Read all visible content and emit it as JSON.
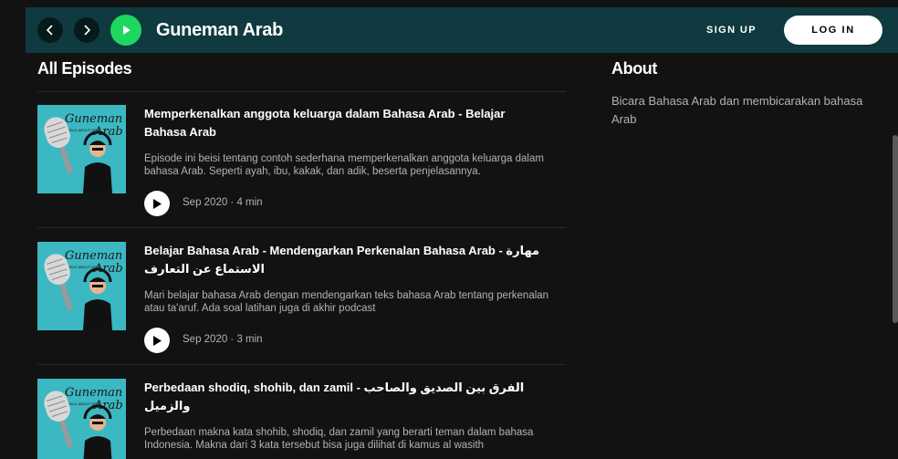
{
  "header": {
    "title": "Guneman Arab",
    "signup_label": "SIGN UP",
    "login_label": "LOG IN"
  },
  "sections": {
    "episodes_title": "All Episodes",
    "about_title": "About",
    "about_text": "Bicara Bahasa Arab dan membicarakan bahasa Arab"
  },
  "cover_art": {
    "brand_line1": "Guneman",
    "brand_line2": "Arab",
    "tagline": "TALK ABOUT ARAB"
  },
  "episodes": [
    {
      "title": "Memperkenalkan anggota keluarga dalam Bahasa Arab - Belajar Bahasa Arab",
      "description": "Episode ini beisi tentang contoh sederhana memperkenalkan anggota keluarga dalam bahasa Arab. Seperti ayah, ibu, kakak, dan adik, beserta penjelasannya.",
      "meta": "Sep 2020 · 4 min"
    },
    {
      "title": "Belajar Bahasa Arab - Mendengarkan Perkenalan Bahasa Arab - مهارة الاستماع عن التعارف",
      "description": "Mari belajar bahasa Arab dengan mendengarkan teks bahasa Arab tentang perkenalan atau ta'aruf. Ada soal latihan juga di akhir podcast",
      "meta": "Sep 2020 · 3 min"
    },
    {
      "title": "Perbedaan shodiq, shohib, dan zamil - الفرق بين الصديق والصاحب والزميل",
      "description": "Perbedaan makna kata shohib, shodiq, dan zamil yang berarti teman dalam bahasa Indonesia. Makna dari 3 kata tersebut bisa juga dilihat di kamus al wasith",
      "meta": ""
    }
  ],
  "colors": {
    "header_bg": "#0f3a3f",
    "accent_green": "#1ed760",
    "cover_teal": "#3bb8c2",
    "background": "#121212"
  }
}
